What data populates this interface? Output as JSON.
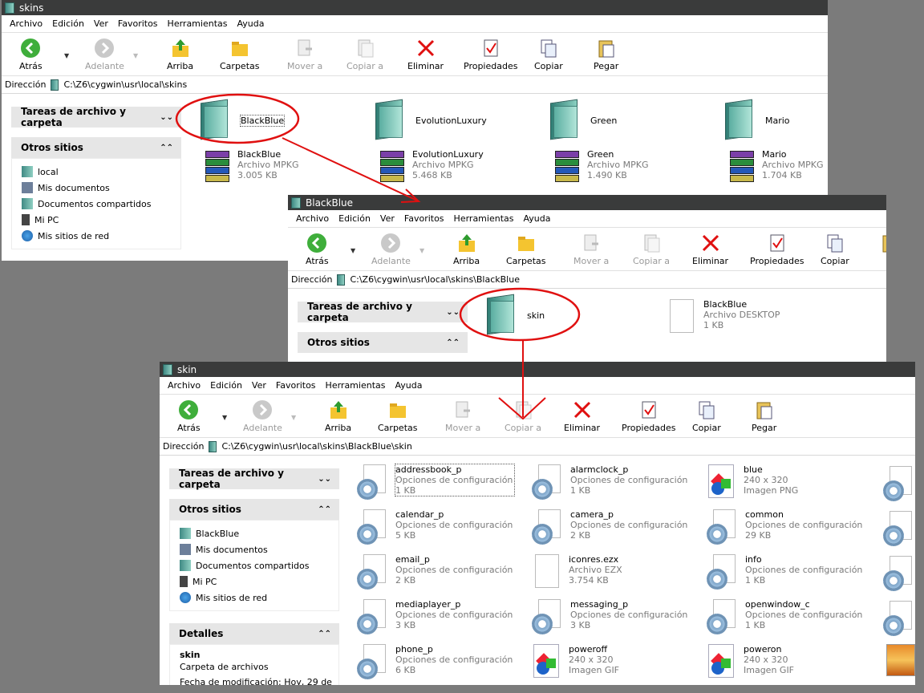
{
  "menu": [
    "Archivo",
    "Edición",
    "Ver",
    "Favoritos",
    "Herramientas",
    "Ayuda"
  ],
  "toolbar": {
    "back": "Atrás",
    "forward": "Adelante",
    "up": "Arriba",
    "folders": "Carpetas",
    "move": "Mover a",
    "copyto": "Copiar a",
    "delete": "Eliminar",
    "props": "Propiedades",
    "copy": "Copiar",
    "paste": "Pegar",
    "paste_partial": "P"
  },
  "address_label": "Dirección",
  "panel": {
    "tasks": "Tareas de archivo y carpeta",
    "others": "Otros sitios",
    "details": "Detalles"
  },
  "win1": {
    "title": "skins",
    "address": "C:\\Z6\\cygwin\\usr\\local\\skins",
    "places": [
      "local",
      "Mis documentos",
      "Documentos compartidos",
      "Mi PC",
      "Mis sitios de red"
    ],
    "folders": [
      "BlackBlue",
      "EvolutionLuxury",
      "Green",
      "Mario"
    ],
    "files": [
      {
        "name": "BlackBlue",
        "type": "Archivo MPKG",
        "size": "3.005 KB"
      },
      {
        "name": "EvolutionLuxury",
        "type": "Archivo MPKG",
        "size": "5.468 KB"
      },
      {
        "name": "Green",
        "type": "Archivo MPKG",
        "size": "1.490 KB"
      },
      {
        "name": "Mario",
        "type": "Archivo MPKG",
        "size": "1.704 KB"
      }
    ]
  },
  "win2": {
    "title": "BlackBlue",
    "address": "C:\\Z6\\cygwin\\usr\\local\\skins\\BlackBlue",
    "folder": "skin",
    "file": {
      "name": "BlackBlue",
      "type": "Archivo DESKTOP",
      "size": "1 KB"
    }
  },
  "win3": {
    "title": "skin",
    "address": "C:\\Z6\\cygwin\\usr\\local\\skins\\BlackBlue\\skin",
    "places": [
      "BlackBlue",
      "Mis documentos",
      "Documentos compartidos",
      "Mi PC",
      "Mis sitios de red"
    ],
    "details": {
      "name": "skin",
      "type": "Carpeta de archivos",
      "modified": "Fecha de modificación: Hoy, 29 de"
    },
    "files": [
      {
        "name": "addressbook_p",
        "type": "Opciones de configuración",
        "size": "1 KB",
        "icon": "gear"
      },
      {
        "name": "alarmclock_p",
        "type": "Opciones de configuración",
        "size": "1 KB",
        "icon": "gear"
      },
      {
        "name": "blue",
        "type": "240 x 320",
        "size": "Imagen PNG",
        "icon": "image"
      },
      {
        "name": "calendar_p",
        "type": "Opciones de configuración",
        "size": "5 KB",
        "icon": "gear"
      },
      {
        "name": "camera_p",
        "type": "Opciones de configuración",
        "size": "2 KB",
        "icon": "gear"
      },
      {
        "name": "common",
        "type": "Opciones de configuración",
        "size": "29 KB",
        "icon": "gear"
      },
      {
        "name": "email_p",
        "type": "Opciones de configuración",
        "size": "2 KB",
        "icon": "gear"
      },
      {
        "name": "iconres.ezx",
        "type": "Archivo EZX",
        "size": "3.754 KB",
        "icon": "blank"
      },
      {
        "name": "info",
        "type": "Opciones de configuración",
        "size": "1 KB",
        "icon": "gear"
      },
      {
        "name": "mediaplayer_p",
        "type": "Opciones de configuración",
        "size": "3 KB",
        "icon": "gear"
      },
      {
        "name": "messaging_p",
        "type": "Opciones de configuración",
        "size": "3 KB",
        "icon": "gear"
      },
      {
        "name": "openwindow_c",
        "type": "Opciones de configuración",
        "size": "1 KB",
        "icon": "gear"
      },
      {
        "name": "phone_p",
        "type": "Opciones de configuración",
        "size": "6 KB",
        "icon": "gear"
      },
      {
        "name": "poweroff",
        "type": "240 x 320",
        "size": "Imagen GIF",
        "icon": "image"
      },
      {
        "name": "poweron",
        "type": "240 x 320",
        "size": "Imagen GIF",
        "icon": "image"
      }
    ]
  },
  "colors": {
    "titlebar": "#3a3b3b",
    "highlight": "#e01010",
    "background": "#7b7b7b"
  }
}
